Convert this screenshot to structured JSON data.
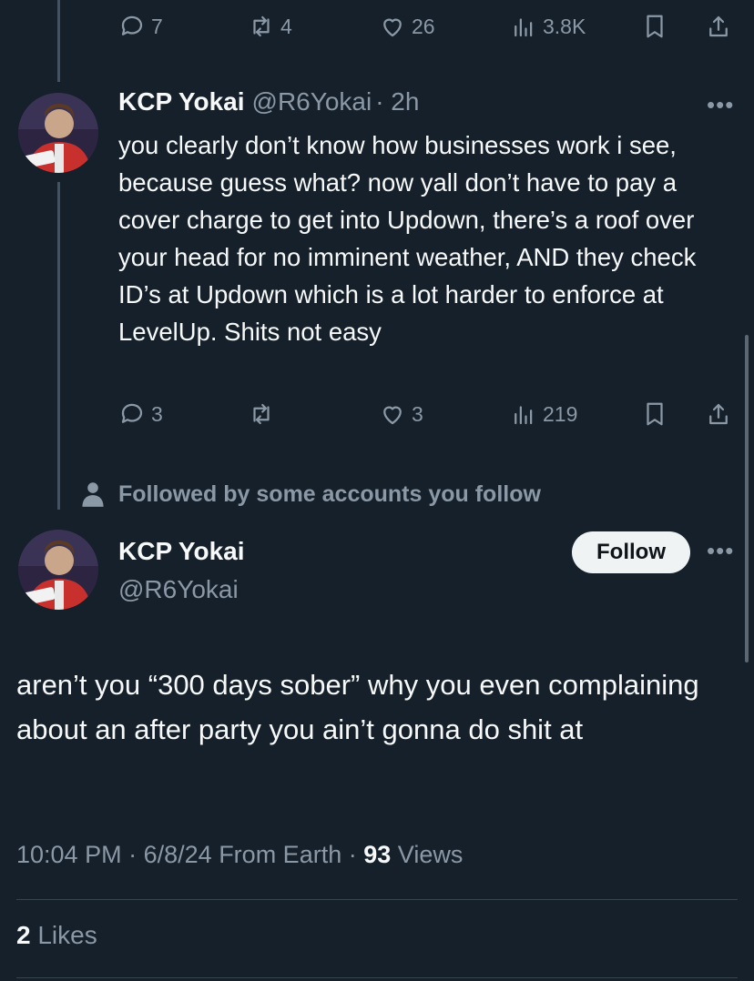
{
  "top_tweet_actions": {
    "replies": "7",
    "retweets": "4",
    "likes": "26",
    "views": "3.8K"
  },
  "reply_tweet": {
    "display_name": "KCP Yokai",
    "handle": "@R6Yokai",
    "time": "· 2h",
    "text": "you clearly don’t know how businesses work i see, because guess what? now yall don’t have to pay a cover charge to get into Updown, there’s a roof over your head for no imminent weather, AND they check ID’s at Updown which is a lot harder to enforce at LevelUp. Shits not easy",
    "actions": {
      "replies": "3",
      "retweets": "",
      "likes": "3",
      "views": "219"
    }
  },
  "social_context": "Followed by some accounts you follow",
  "main_tweet": {
    "display_name": "KCP Yokai",
    "handle": "@R6Yokai",
    "follow_label": "Follow",
    "text": "aren’t you “300 days sober” why you even complaining about an after party you ain’t gonna do shit at",
    "time": "10:04 PM",
    "date": "6/8/24",
    "source": "From Earth",
    "views_count": "93",
    "views_label": "Views",
    "likes_count": "2",
    "likes_label": "Likes"
  },
  "colors": {
    "background": "#15202b",
    "text": "#f7f9f9",
    "muted": "#8b98a5",
    "thread_line": "#425364"
  }
}
